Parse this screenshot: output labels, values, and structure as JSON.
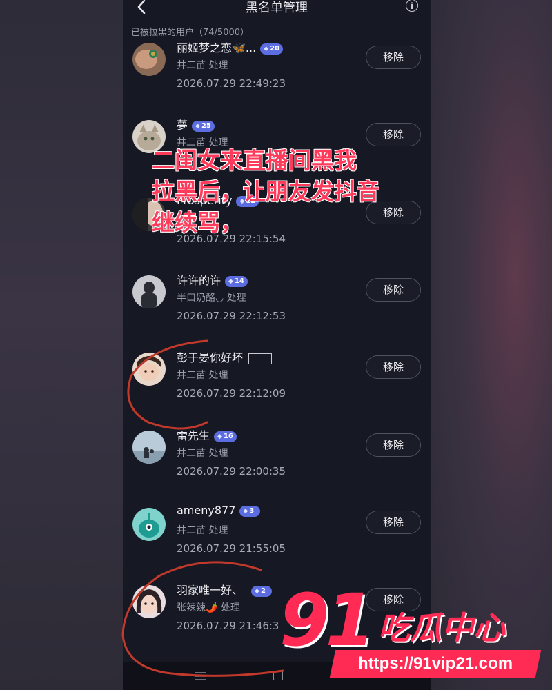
{
  "header": {
    "title": "黑名单管理",
    "info_glyph": "i",
    "subtitle": "已被拉黑的用户（74/5000）"
  },
  "rows": [
    {
      "name": "丽姬梦之恋🦋...",
      "level": "20",
      "handler": "井二苗 处理",
      "time": "2026.07.29 22:49:23",
      "button": "移除"
    },
    {
      "name": "夢",
      "level": "25",
      "handler": "井二苗 处理",
      "time": "",
      "button": "移除"
    },
    {
      "name": "Prosperity",
      "level": "12",
      "handler": "处理",
      "time": "2026.07.29 22:15:54",
      "button": "移除"
    },
    {
      "name": "许许的许",
      "level": "14",
      "handler": "半口奶酪◡ 处理",
      "time": "2026.07.29 22:12:53",
      "button": "移除"
    },
    {
      "name": "彭于晏你好坏",
      "level": "",
      "handler": "井二苗 处理",
      "time": "2026.07.29 22:12:09",
      "button": "移除"
    },
    {
      "name": "雷先生",
      "level": "16",
      "handler": "井二苗 处理",
      "time": "2026.07.29 22:00:35",
      "button": "移除"
    },
    {
      "name": "ameny877",
      "level": "3",
      "handler": "井二苗 处理",
      "time": "2026.07.29 21:55:05",
      "button": "移除"
    },
    {
      "name": "羽家唯一好、",
      "level": "2",
      "handler": "张辣辣🌶️ 处理",
      "time": "2026.07.29 21:46:3",
      "button": "移除"
    }
  ],
  "overlay": {
    "lines": [
      "二闺女来直播间黑我",
      "拉黑后，让朋友发抖音",
      "继续骂，"
    ]
  },
  "watermark": {
    "number": "91",
    "text": "吃瓜中心",
    "url": "https://91vip21.com"
  },
  "colors": {
    "accent_red": "#ff2b55",
    "badge_blue": "#5b6de0",
    "panel_bg": "#161824"
  }
}
